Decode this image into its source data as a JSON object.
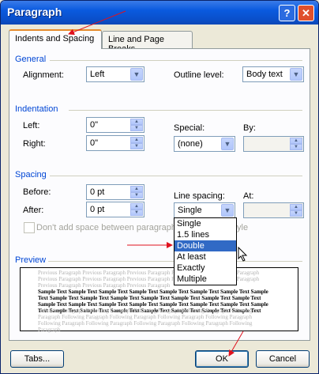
{
  "window": {
    "title": "Paragraph",
    "help_glyph": "?",
    "close_glyph": "✕"
  },
  "tabs": [
    {
      "label": "Indents and Spacing",
      "active": true
    },
    {
      "label": "Line and Page Breaks",
      "active": false
    }
  ],
  "general": {
    "header": "General",
    "alignment": {
      "label": "Alignment:",
      "value": "Left"
    },
    "outline_level": {
      "label": "Outline level:",
      "value": "Body text"
    }
  },
  "indentation": {
    "header": "Indentation",
    "left": {
      "label": "Left:",
      "value": "0\""
    },
    "right": {
      "label": "Right:",
      "value": "0\""
    },
    "special": {
      "label": "Special:",
      "value": "(none)"
    },
    "by": {
      "label": "By:",
      "value": ""
    }
  },
  "spacing": {
    "header": "Spacing",
    "before": {
      "label": "Before:",
      "value": "0 pt"
    },
    "after": {
      "label": "After:",
      "value": "0 pt"
    },
    "line_spacing": {
      "label": "Line spacing:",
      "value": "Single",
      "options": [
        "Single",
        "1.5 lines",
        "Double",
        "At least",
        "Exactly",
        "Multiple"
      ],
      "highlighted": "Double"
    },
    "at": {
      "label": "At:",
      "value": ""
    },
    "dont_add_space": {
      "label_left": "Don't add space between paragraph",
      "label_right": "yle",
      "checked": false
    }
  },
  "preview": {
    "header": "Preview",
    "prev_text": "Previous Paragraph Previous Paragraph Previous Paragraph Previous Paragraph Previous Paragraph Previous Paragraph Previous Paragraph Previous Paragraph Previous Paragraph Previous Paragraph Previous Paragraph Previous Paragraph Previous Paragraph",
    "sample_text": "Sample Text Sample Text Sample Text Sample Text Sample Text Sample Text Sample Text Sample Text Sample Text Sample Text Sample Text Sample Text Sample Text Sample Text Sample Text Sample Text Sample Text Sample Text Sample Text Sample Text Sample Text Sample Text Sample Text Sample Text Sample Text Sample Text Sample Text Sample Text Sample Text Sample Text",
    "follow_text": "Following Paragraph Following Paragraph Following Paragraph Following Paragraph Following Paragraph Following Paragraph Following Paragraph Following Paragraph Following Paragraph Following Paragraph Following Paragraph Following Paragraph Following Paragraph Following Paragraph"
  },
  "buttons": {
    "tabs": "Tabs...",
    "ok": "OK",
    "cancel": "Cancel"
  },
  "colors": {
    "annotation_arrow": "#e0121e",
    "section_header": "#0046d5",
    "selection": "#316ac5"
  }
}
